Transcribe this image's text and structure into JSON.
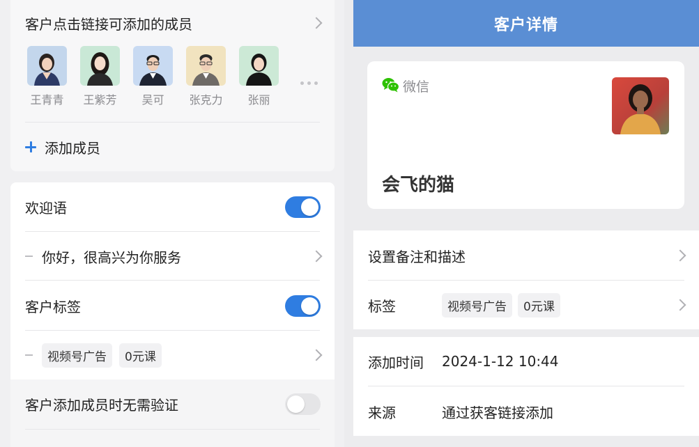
{
  "left": {
    "link_members_title": "客户点击链接可添加的成员",
    "members": [
      {
        "name": "王青青",
        "bg": "#c3d6ec"
      },
      {
        "name": "王紫芳",
        "bg": "#c9e8d6"
      },
      {
        "name": "吴可",
        "bg": "#c8daf2"
      },
      {
        "name": "张克力",
        "bg": "#f1e3bf"
      },
      {
        "name": "张丽",
        "bg": "#cce9d6"
      }
    ],
    "add_member_label": "添加成员",
    "welcome_label": "欢迎语",
    "welcome_enabled": true,
    "welcome_text": "你好，很高兴为你服务",
    "customer_tags_label": "客户标签",
    "customer_tags_enabled": true,
    "tags": [
      "视频号广告",
      "0元课"
    ],
    "no_verify_label": "客户添加成员时无需验证",
    "no_verify_enabled": false
  },
  "right": {
    "header_title": "客户详情",
    "source_app": "微信",
    "customer_name": "会飞的猫",
    "set_remark_label": "设置备注和描述",
    "tags_label": "标签",
    "tags": [
      "视频号广告",
      "0元课"
    ],
    "add_time_label": "添加时间",
    "add_time_value": "2024-1-12 10:44",
    "source_label": "来源",
    "source_value": "通过获客链接添加"
  },
  "colors": {
    "accent": "#2f7de1",
    "header": "#5a8ed4",
    "wechat": "#2dc100"
  }
}
